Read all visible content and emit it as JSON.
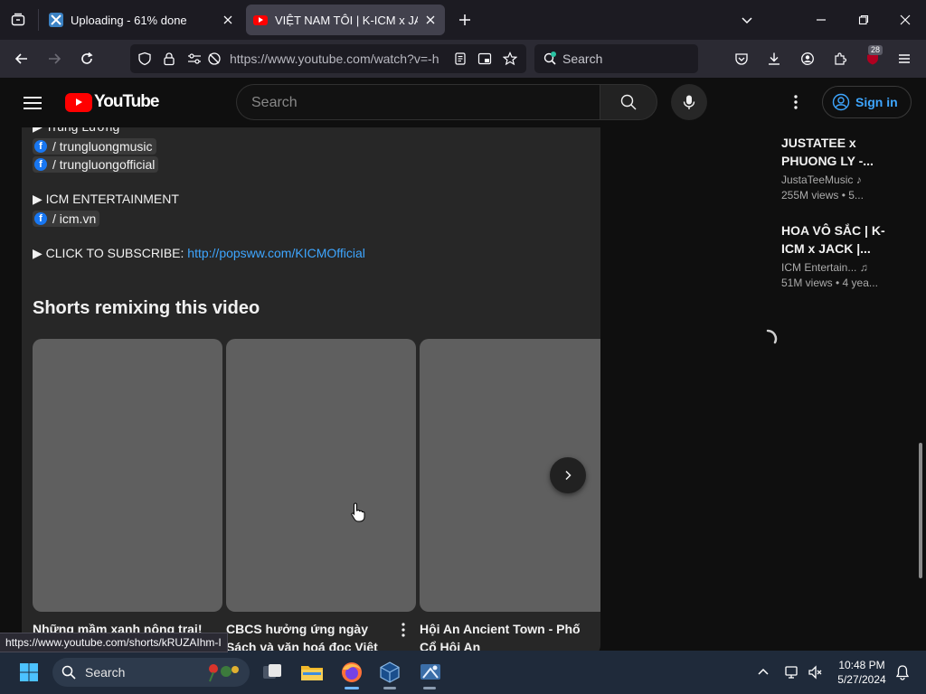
{
  "browser": {
    "tabs": [
      {
        "title": "Uploading - 61% done",
        "active": false
      },
      {
        "title": "VIỆT NAM TÔI | K-ICM x JACK | Official MV",
        "active": true
      }
    ],
    "url": "https://www.youtube.com/watch?v=-h",
    "search_placeholder": "Search",
    "extension_badge": "28",
    "status_url": "https://www.youtube.com/shorts/kRUZAIhm-I"
  },
  "youtube": {
    "logo_text": "YouTube",
    "search_placeholder": "Search",
    "sign_in_label": "Sign in",
    "description": {
      "lines": [
        "▶ Trung Lương",
        "/ trungluongmusic",
        "/ trungluongofficial",
        "▶ ICM ENTERTAINMENT",
        "/ icm.vn",
        "▶ CLICK TO SUBSCRIBE: ",
        "http://popsww.com/KICMOfficial"
      ]
    },
    "shorts_section_title": "Shorts remixing this video",
    "shorts": [
      {
        "title": "Những mầm xanh nông trại!"
      },
      {
        "title": "CBCS hưởng ứng ngày Sách và văn hoá đọc Việt Nam..."
      },
      {
        "title": "Hội An Ancient Town - Phố Cổ Hội An"
      }
    ],
    "recommendations": [
      {
        "title": "JUSTATEE x PHUONG LY -...",
        "channel": "JustaTeeMusic",
        "meta": "255M views • 5..."
      },
      {
        "title": "HOA VÔ SẮC | K-ICM x JACK |...",
        "channel": "ICM Entertain...",
        "meta": "51M views • 4 yea..."
      }
    ]
  },
  "taskbar": {
    "search_placeholder": "Search",
    "time": "10:48 PM",
    "date": "5/27/2024"
  },
  "colors": {
    "youtube_red": "#ff0000",
    "link_blue": "#3ea6ff",
    "facebook_blue": "#1877f2"
  }
}
